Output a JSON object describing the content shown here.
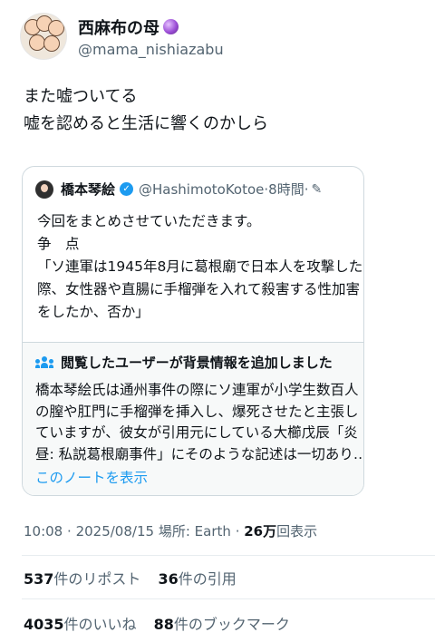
{
  "author": {
    "display_name": "西麻布の母",
    "handle": "@mama_nishiazabu",
    "badge_icon": "crystal-ball-icon"
  },
  "tweet": {
    "lines": [
      "また嘘ついてる",
      "嘘を認めると生活に響くのかしら"
    ]
  },
  "quoted_tweet": {
    "display_name": "橋本琴絵",
    "handle": "@HashimotoKotoe",
    "time": "8時間",
    "lines": [
      "今回をまとめさせていただきます。",
      "争　点",
      "「ソ連軍は1945年8月に葛根廟で日本人を攻撃した",
      "際、女性器や直腸に手榴弾を入れて殺害する性加害",
      "をしたか、否か」"
    ]
  },
  "community_note": {
    "title": "閲覧したユーザーが背景情報を追加しました",
    "lines": [
      "橋本琴絵氏は通州事件の際にソ連軍が小学生数百人",
      "の膣や肛門に手榴弾を挿入し、爆死させたと主張し",
      "ていますが、彼女が引用元にしている大櫛戊辰「炎",
      "昼: 私説葛根廟事件」にそのような記述は一切あり…"
    ],
    "link_label": "このノートを表示"
  },
  "meta": {
    "time": "10:08",
    "date": "2025/08/15",
    "location_label": "場所:",
    "location": "Earth",
    "views_count": "26万",
    "views_label": "回表示"
  },
  "stats": {
    "reposts_count": "537",
    "reposts_label": "件のリポスト",
    "quotes_count": "36",
    "quotes_label": "件の引用",
    "likes_count": "4035",
    "likes_label": "件のいいね",
    "bookmarks_count": "88",
    "bookmarks_label": "件のブックマーク"
  }
}
